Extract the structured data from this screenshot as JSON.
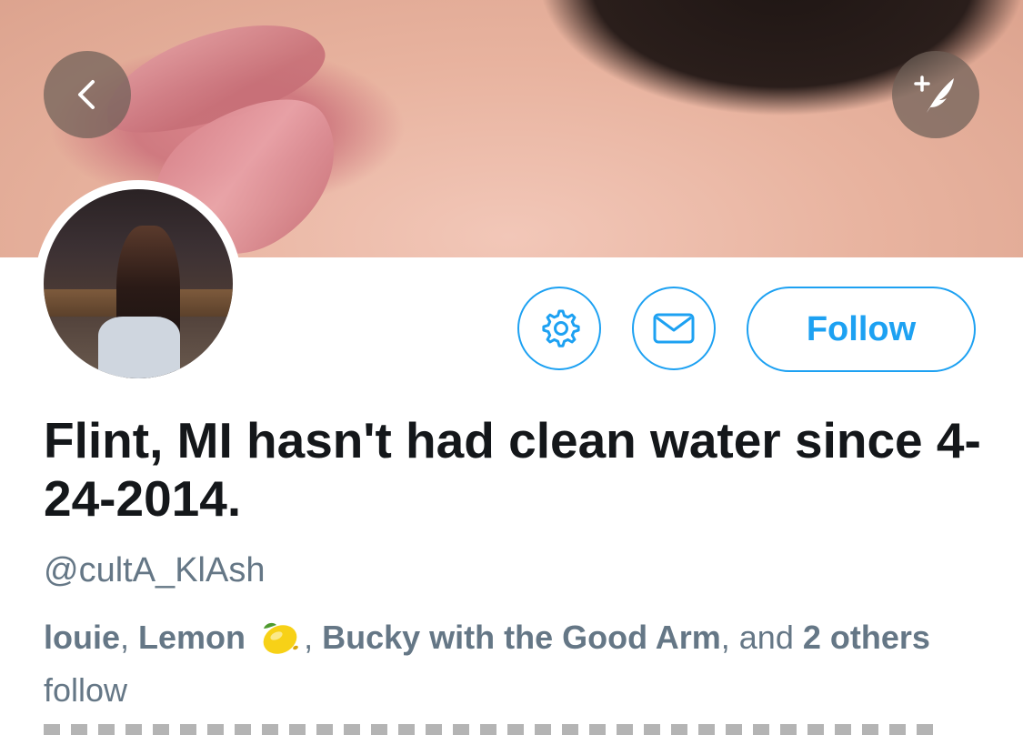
{
  "header": {
    "back_icon": "chevron-left-icon",
    "compose_icon": "compose-quill-icon"
  },
  "actions": {
    "settings_icon": "gear-icon",
    "message_icon": "envelope-icon",
    "follow_label": "Follow"
  },
  "profile": {
    "display_name": "Flint, MI hasn't had clean water since 4-24-2014.",
    "handle": "@cultA_KlAsh"
  },
  "followed_by": {
    "name1": "louie",
    "sep1": ", ",
    "name2": "Lemon",
    "sep2": ", ",
    "name3": "Bucky with the Good Arm",
    "sep3": ", and ",
    "count": "2",
    "others": "others",
    "suffix": " follow"
  },
  "colors": {
    "accent": "#1da1f2",
    "text_primary": "#14171a",
    "text_secondary": "#657786"
  }
}
